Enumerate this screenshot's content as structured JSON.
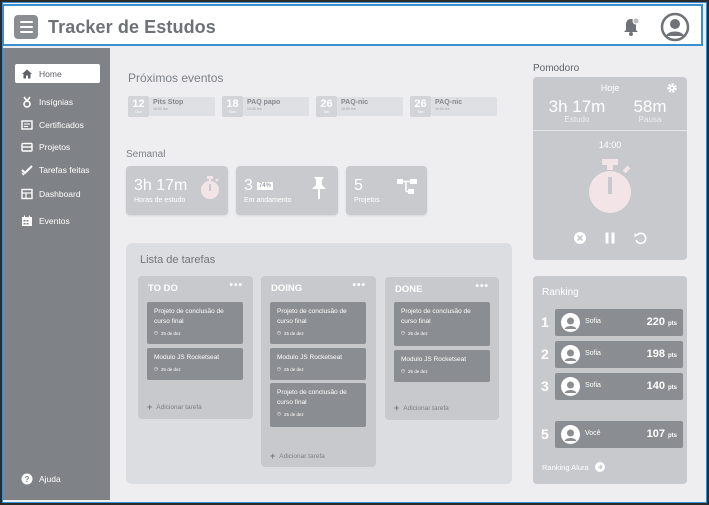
{
  "app": {
    "title": "Tracker de Estudos"
  },
  "header": {
    "menu_icon": "hamburger-icon",
    "notification_icon": "bell-icon",
    "profile_icon": "user-icon"
  },
  "sidebar": {
    "items": [
      {
        "label": "Home",
        "icon": "home-icon",
        "active": true
      },
      {
        "label": "Insígnias",
        "icon": "medal-icon"
      },
      {
        "label": "Certificados",
        "icon": "certificate-icon"
      },
      {
        "label": "Projetos",
        "icon": "folder-icon"
      },
      {
        "label": "Tarefas feitas",
        "icon": "check-icon"
      },
      {
        "label": "Dashboard",
        "icon": "dashboard-icon"
      },
      {
        "label": "Eventos",
        "icon": "calendar-icon"
      }
    ],
    "help_label": "Ajuda"
  },
  "events": {
    "title": "Próximos eventos",
    "items": [
      {
        "day": "12",
        "month": "Out",
        "name": "Pits Stop",
        "time": "10:00 hrs"
      },
      {
        "day": "18",
        "month": "Nov",
        "name": "PAQ papo",
        "time": "10:00 hrs"
      },
      {
        "day": "26",
        "month": "Set",
        "name": "PAQ-nic",
        "time": "10:00 hrs"
      },
      {
        "day": "26",
        "month": "Set",
        "name": "PAQ-nic",
        "time": "10:00 hrs"
      }
    ]
  },
  "weekly": {
    "title": "Semanal",
    "study": {
      "value": "3h 17m",
      "label": "Horas de estudo",
      "icon": "stopwatch-icon"
    },
    "progress": {
      "value": "3",
      "percent": "74%",
      "label": "Em andamento",
      "icon": "pin-icon"
    },
    "projects": {
      "value": "5",
      "label": "Projetos",
      "icon": "hierarchy-icon"
    }
  },
  "tasks": {
    "title": "Lista de tarefas",
    "more": "•••",
    "add_label": "Adicionar tarefa",
    "columns": [
      {
        "title": "TO DO",
        "cards": [
          {
            "title": "Projeto de conclusão de curso final",
            "date": "25 de dez"
          },
          {
            "title": "Modulo JS Rocketseat",
            "date": "25 de dez"
          }
        ]
      },
      {
        "title": "DOING",
        "cards": [
          {
            "title": "Projeto de conclusão de curso final",
            "date": "25 de dez"
          },
          {
            "title": "Modulo JS Rocketseat",
            "date": "25 de dez"
          },
          {
            "title": "Projeto de conclusão de curso final",
            "date": "25 de dez"
          }
        ]
      },
      {
        "title": "DONE",
        "cards": [
          {
            "title": "Projeto de conclusão de curso final",
            "date": "25 de dez"
          },
          {
            "title": "Modulo JS Rocketseat",
            "date": "25 de dez"
          }
        ]
      }
    ]
  },
  "pomodoro": {
    "title": "Pomodoro",
    "today_label": "Hoje",
    "study_value": "3h 17m",
    "study_label": "Estudo",
    "pause_value": "58m",
    "pause_label": "Pausa",
    "timer": "14:00"
  },
  "ranking": {
    "title": "Ranking",
    "pts_unit": "pts",
    "rows": [
      {
        "pos": "1",
        "name": "Sofia",
        "points": "220"
      },
      {
        "pos": "2",
        "name": "Sofia",
        "points": "198"
      },
      {
        "pos": "3",
        "name": "Sofia",
        "points": "140"
      },
      {
        "pos": "5",
        "name": "Você",
        "points": "107"
      }
    ],
    "link_label": "Ranking Alura"
  },
  "colors": {
    "accent": "#3b8fd0",
    "sidebar": "#7f8287",
    "card": "#c8c9cd",
    "timer_face": "#f3e5e7"
  }
}
